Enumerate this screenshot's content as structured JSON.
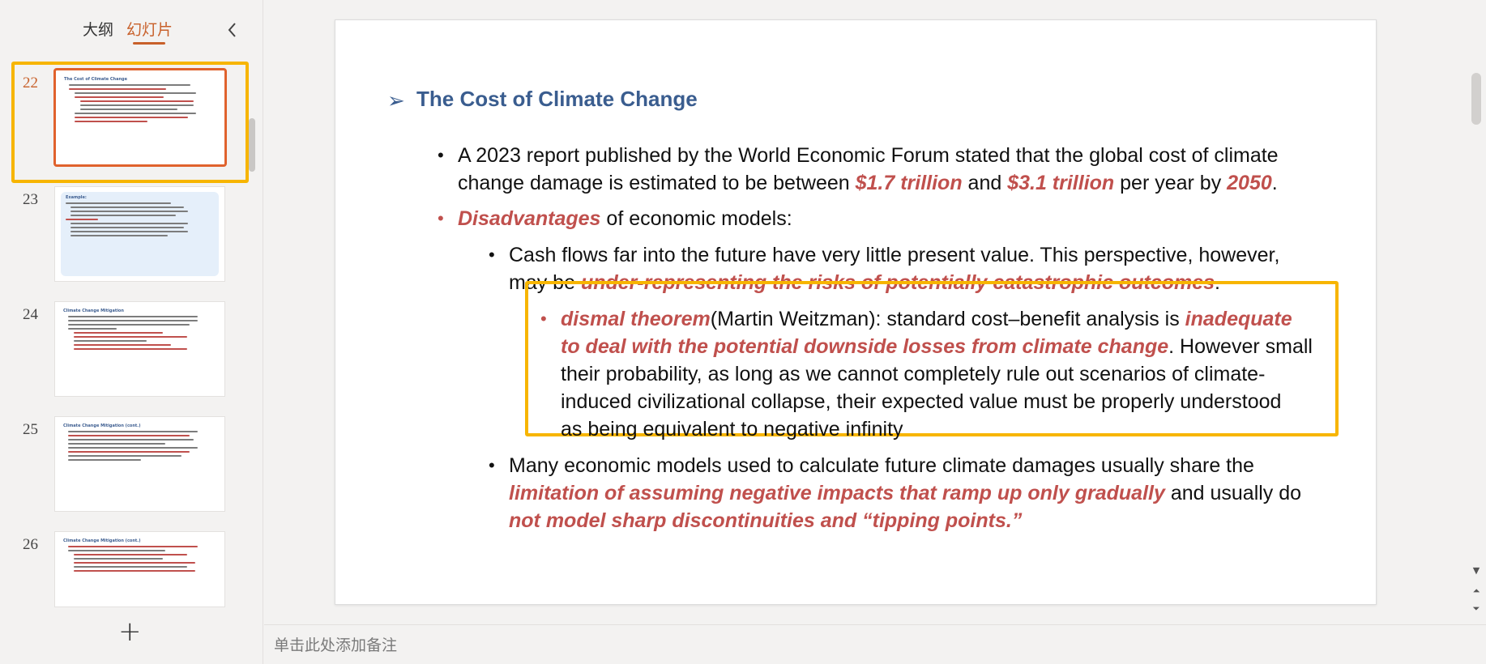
{
  "panel": {
    "tab_outline": "大纲",
    "tab_slides": "幻灯片",
    "add_slide": "+"
  },
  "thumbnails": [
    {
      "number": "22",
      "title": "The Cost of Climate Change",
      "selected": true
    },
    {
      "number": "23",
      "title": "Example:"
    },
    {
      "number": "24",
      "title": "Climate Change Mitigation"
    },
    {
      "number": "25",
      "title": "Climate Change Mitigation (cont.)"
    },
    {
      "number": "26",
      "title": "Climate Change Mitigation (cont.)"
    }
  ],
  "slide": {
    "title": "The Cost of Climate Change",
    "p1_l1": "A 2023 report published by the World Economic Forum stated that the global cost of climate",
    "p1_l2_a": "change damage is estimated to be between ",
    "p1_l2_b": "$1.7 trillion",
    "p1_l2_c": " and ",
    "p1_l2_d": "$3.1 trillion",
    "p1_l2_e": " per year by ",
    "p1_l2_f": "2050",
    "p1_l2_g": ".",
    "p2_a": "Disadvantages",
    "p2_b": " of economic models:",
    "p3_l1": "Cash flows far into the future have very little present value. This perspective, however,",
    "p3_l2_a": "may be ",
    "p3_l2_b": "under-representing the risks of potentially catastrophic outcomes",
    "p3_l2_c": ".",
    "p4_l1_a": "dismal theorem",
    "p4_l1_b": "(Martin Weitzman): standard cost–benefit analysis is ",
    "p4_l1_c": "inadequate",
    "p4_l2_a": "to deal with the potential downside losses from climate change",
    "p4_l2_b": ". However small",
    "p4_l3": "their probability, as long as we cannot completely rule out scenarios of climate-",
    "p4_l4": "induced civilizational collapse, their expected value must be properly understood",
    "p4_l5": "as being equivalent to negative infinity",
    "p5_l1": "Many economic models used to calculate future climate damages usually share the",
    "p5_l2_a": "limitation of assuming negative impacts that ramp up only gradually",
    "p5_l2_b": " and usually do",
    "p5_l3": "not model sharp discontinuities and “tipping points.”"
  },
  "notes": {
    "placeholder": "单击此处添加备注"
  },
  "colors": {
    "accent_orange": "#c8602a",
    "highlight_yellow": "#f7b500",
    "title_blue": "#3a5d8f",
    "emphasis_red": "#c0504d"
  }
}
